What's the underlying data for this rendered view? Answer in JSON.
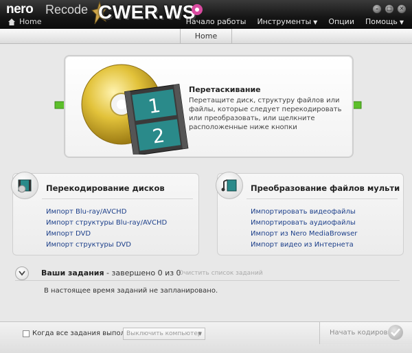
{
  "titlebar": {
    "logo": "nero",
    "product": "Recode",
    "watermark": "CWER.WS",
    "home_crumb": "Home",
    "menu": [
      {
        "label": "Начало работы",
        "has_arrow": false
      },
      {
        "label": "Инструменты",
        "has_arrow": true
      },
      {
        "label": "Опции",
        "has_arrow": false
      },
      {
        "label": "Помощь",
        "has_arrow": true
      }
    ],
    "window_buttons": [
      "minimize-icon",
      "restore-icon",
      "close-icon"
    ]
  },
  "homebar": {
    "label": "Home"
  },
  "dropzone": {
    "title": "Перетаскивание",
    "description": "Перетащите диск, структуру файлов или файлы, которые следует перекодировать или преобразовать, или щелкните расположенные ниже кнопки",
    "film_numbers": [
      "1",
      "2"
    ]
  },
  "panels": {
    "discs": {
      "title": "Перекодирование дисков",
      "links": [
        "Импорт Blu-ray/AVCHD",
        "Импорт структуры Blu-ray/AVCHD",
        "Импорт DVD",
        "Импорт структуры DVD"
      ]
    },
    "media": {
      "title": "Преобразование файлов мультиме...",
      "links": [
        "Импортировать видеофайлы",
        "Импортировать аудиофайлы",
        "Импорт из Nero MediaBrowser",
        "Импорт видео из Интернета"
      ]
    }
  },
  "jobs": {
    "title": "Ваши задания",
    "status": " - завершено 0 из 0",
    "clear": "Очистить список заданий",
    "empty": "В настоящее время заданий не запланировано."
  },
  "bottom": {
    "checkbox_label": "Когда все задания выполнены:",
    "select_value": "Выключить компьютер",
    "start_label": "Начать кодировку"
  },
  "colors": {
    "link": "#1c3f8a",
    "arrow_green": "#5cbf2a",
    "disc_gold": "#e2c23a",
    "film_teal": "#2a8a8a"
  }
}
